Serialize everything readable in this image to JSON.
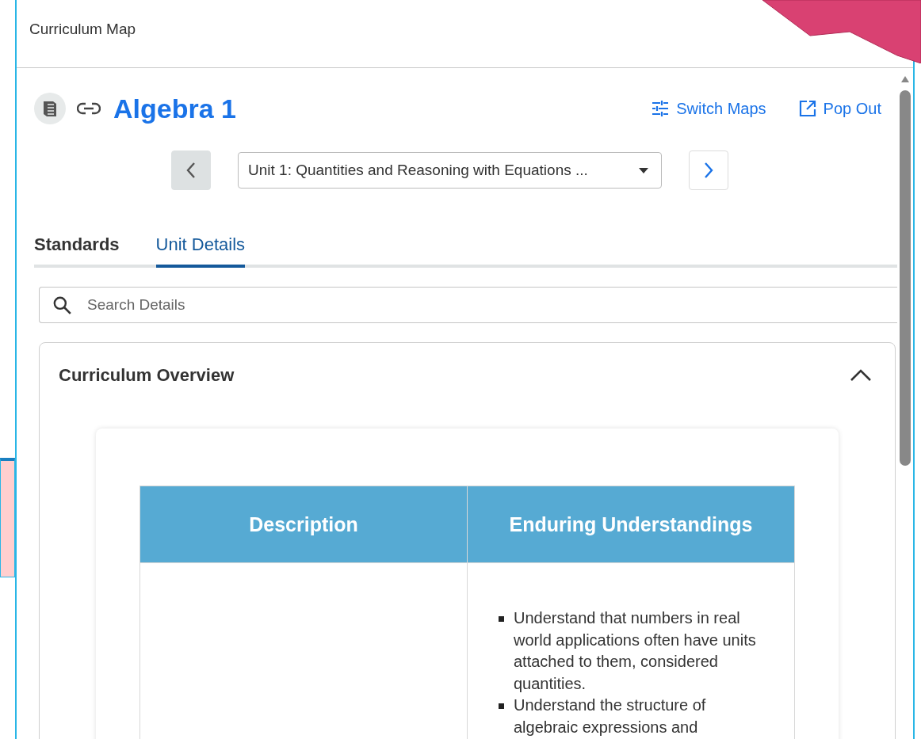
{
  "window": {
    "title": "Curriculum Map"
  },
  "map": {
    "title": "Algebra 1",
    "actions": [
      {
        "label": "Switch Maps",
        "kind": "switch"
      },
      {
        "label": "Pop Out",
        "kind": "popout"
      }
    ]
  },
  "unit_nav": {
    "previous": {
      "disabled": true
    },
    "unit": "Unit 1: Quantities and Reasoning with Equations ...",
    "next": {
      "disabled": false
    }
  },
  "tabs": [
    {
      "label": "Standards",
      "selected": false
    },
    {
      "label": "Unit Details",
      "selected": true
    }
  ],
  "search": {
    "placeholder": "Search Details"
  },
  "section": {
    "title": "Curriculum Overview",
    "expanded": true,
    "table": {
      "columns": [
        "Description",
        "Enduring Understandings"
      ],
      "rows": [
        {
          "enduring_understandings": [
            "Understand that numbers in real world applications often have units attached to them, considered quantities.",
            "Understand the structure of algebraic expressions and"
          ]
        }
      ]
    }
  }
}
